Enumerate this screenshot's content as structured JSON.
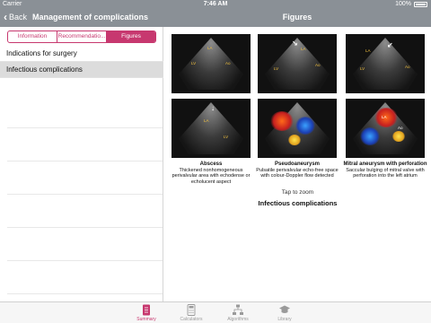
{
  "status_bar": {
    "carrier": "Carrier",
    "time": "7:46 AM",
    "battery": "100%"
  },
  "nav": {
    "back_label": "Back",
    "master_title": "Management of complications",
    "detail_title": "Figures"
  },
  "segments": [
    {
      "label": "Information",
      "active": false
    },
    {
      "label": "Recommendatio...",
      "active": false
    },
    {
      "label": "Figures",
      "active": true
    }
  ],
  "list_items": [
    {
      "label": "Indications for surgery",
      "selected": false
    },
    {
      "label": "Infectious complications",
      "selected": true
    }
  ],
  "figures": [
    {
      "labels": [
        "LA",
        "LV",
        "Ao"
      ]
    },
    {
      "labels": [
        "LA",
        "LV",
        "Ao"
      ]
    },
    {
      "labels": [
        "LA",
        "LV",
        "Ao"
      ]
    },
    {
      "labels": [
        "LA",
        "LV"
      ]
    },
    {
      "labels": [],
      "caption_title": "Abscess",
      "caption_text": "Thickened nonhomogeneous perivalvular area with echodense or echolucent aspect"
    },
    {
      "labels": [],
      "caption_title": "Pseudoaneurysm",
      "caption_text": "Pulsatile perivalvular echo-free space with colour-Doppler flow detected"
    },
    {
      "labels": [
        "LA",
        "Ao"
      ],
      "caption_title": "Mitral aneurysm with perforation",
      "caption_text": "Saccular bulging of mitral valve with perforation into the left atrium"
    }
  ],
  "detail": {
    "tap_to_zoom": "Tap to zoom",
    "section_title": "Infectious complications"
  },
  "tabs": [
    {
      "label": "Summary",
      "icon": "summary-document-icon",
      "active": true
    },
    {
      "label": "Calculators",
      "icon": "calculator-icon",
      "active": false
    },
    {
      "label": "Algorithms",
      "icon": "algorithm-flow-icon",
      "active": false
    },
    {
      "label": "Library",
      "icon": "graduation-cap-icon",
      "active": false
    }
  ],
  "colors": {
    "accent": "#c7386f",
    "nav_bar": "#8a9096",
    "selected_row": "#dcdcdc"
  }
}
